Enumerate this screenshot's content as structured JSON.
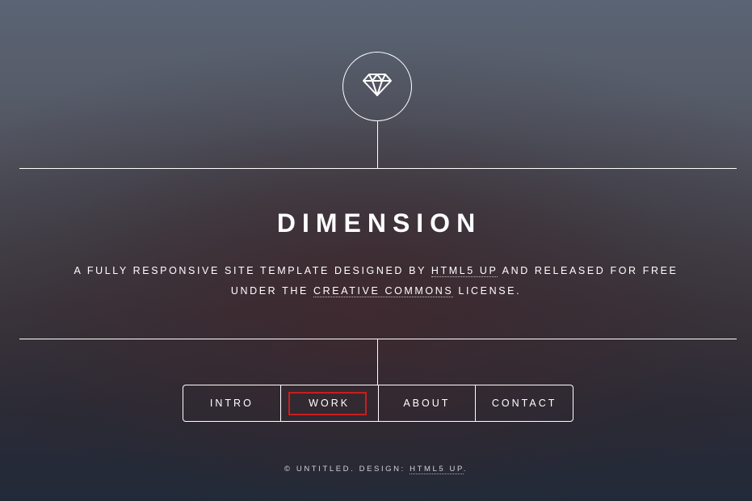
{
  "header": {
    "logo_icon": "gem-icon",
    "title": "DIMENSION",
    "tagline": {
      "part1": "A FULLY RESPONSIVE SITE TEMPLATE DESIGNED BY ",
      "link1": "HTML5 UP",
      "part2": " AND RELEASED FOR FREE UNDER THE ",
      "link2": "CREATIVE COMMONS",
      "part3": " LICENSE."
    }
  },
  "nav": {
    "items": [
      {
        "label": "INTRO"
      },
      {
        "label": "WORK"
      },
      {
        "label": "ABOUT"
      },
      {
        "label": "CONTACT"
      }
    ],
    "highlight_color": "#c81e1e"
  },
  "footer": {
    "text": "© UNTITLED. DESIGN: ",
    "link": "HTML5 UP",
    "end": "."
  }
}
